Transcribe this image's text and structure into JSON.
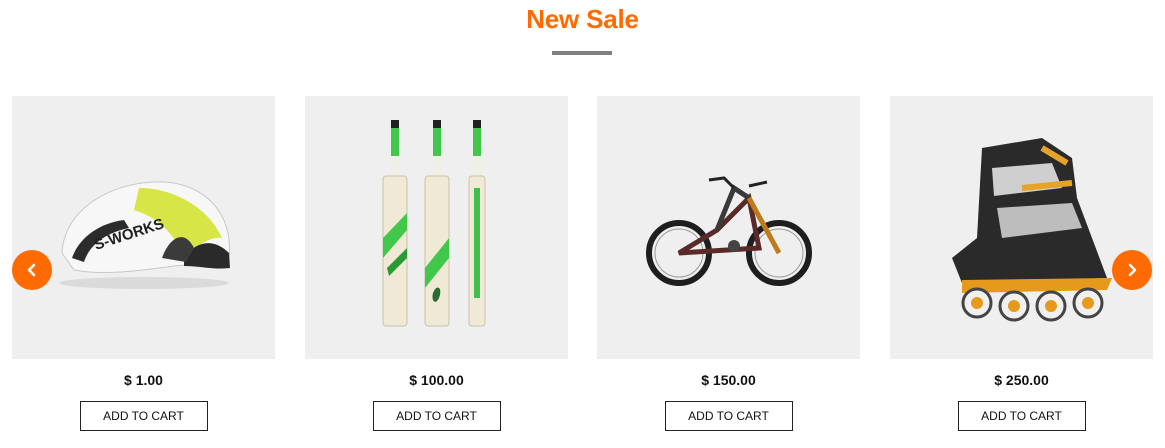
{
  "section": {
    "title": "New Sale"
  },
  "carousel": {
    "prev_icon": "chevron-left-icon",
    "next_icon": "chevron-right-icon",
    "accent_color": "#ff6b00"
  },
  "products": [
    {
      "name": "cycling helmet",
      "price": "$ 1.00",
      "cta": "ADD TO CART"
    },
    {
      "name": "cricket bats",
      "price": "$ 100.00",
      "cta": "ADD TO CART"
    },
    {
      "name": "mountain bike",
      "price": "$ 150.00",
      "cta": "ADD TO CART"
    },
    {
      "name": "inline skate",
      "price": "$ 250.00",
      "cta": "ADD TO CART"
    }
  ]
}
